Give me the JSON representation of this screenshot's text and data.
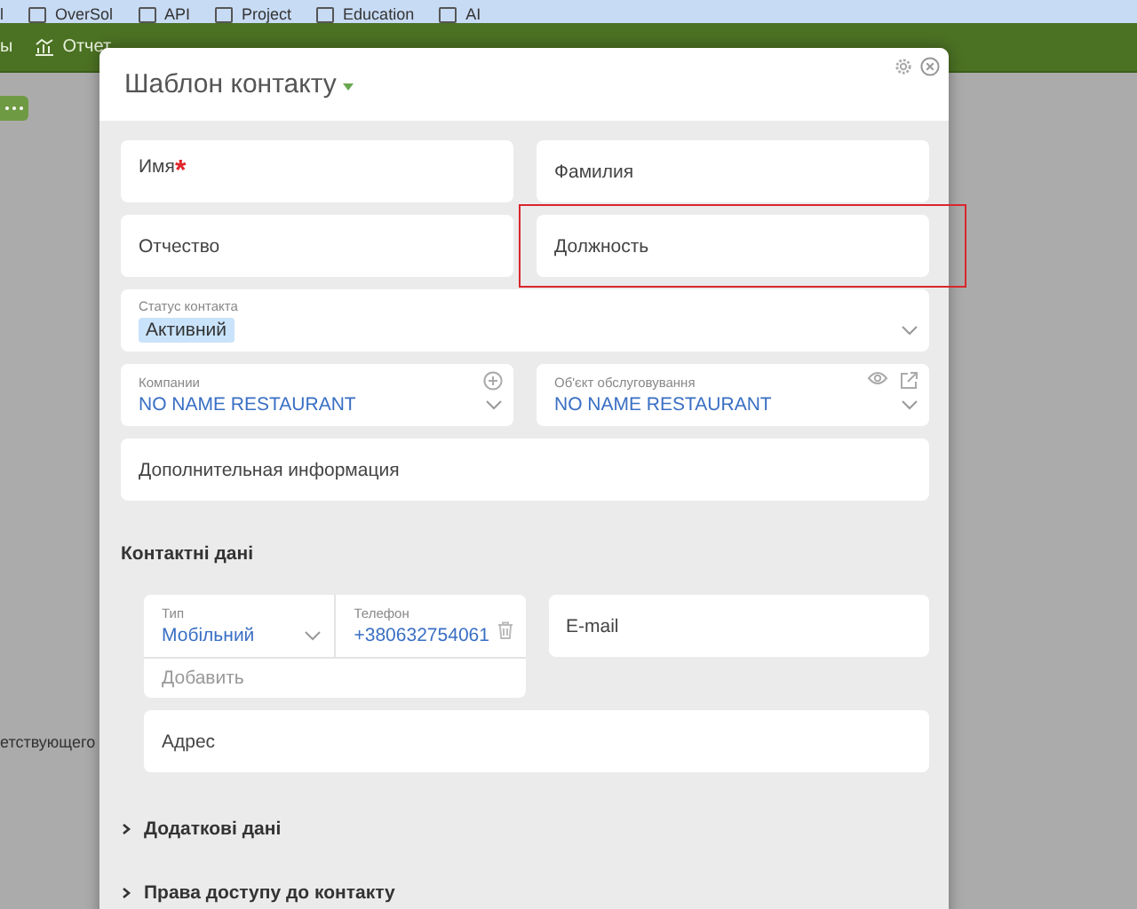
{
  "bookmarks": [
    {
      "label": "l"
    },
    {
      "label": "OverSol"
    },
    {
      "label": "API"
    },
    {
      "label": "Project"
    },
    {
      "label": "Education"
    },
    {
      "label": "AI"
    }
  ],
  "app_bar": {
    "items": [
      {
        "label": "ы",
        "kind": "text"
      },
      {
        "label": "Отчет",
        "kind": "reports"
      }
    ]
  },
  "background_text": "етствующего",
  "dialog": {
    "title": "Шаблон контакту",
    "fields": [
      {
        "kind": "text",
        "label": "Имя",
        "required_mark": "*",
        "highlighted": false
      },
      {
        "kind": "text",
        "label": "Фамилия",
        "highlighted": false
      },
      {
        "kind": "text",
        "label": "Отчество",
        "highlighted": false
      },
      {
        "kind": "text",
        "label": "Должность",
        "highlighted": true
      },
      {
        "kind": "tags",
        "label": "Статус контакта",
        "tags": [
          "Активний"
        ]
      },
      {
        "kind": "lookup",
        "label": "Компании",
        "value": "NO NAME RESTAURANT",
        "add_button": true
      },
      {
        "kind": "lookup",
        "label": "Об'єкт обслуговування",
        "value": "NO NAME RESTAURANT",
        "view_button": true,
        "open_button": true
      },
      {
        "kind": "memo",
        "label": "Дополнительная информация"
      }
    ],
    "contacts": {
      "title": "Контактні дані",
      "phone": {
        "type_label": "Тип",
        "type": "Мобільний",
        "number_label": "Телефон",
        "number": "+380632754061",
        "add": "Добавить"
      },
      "email": {
        "label": "E-mail"
      },
      "address": {
        "label": "Адрес"
      }
    },
    "sections": [
      {
        "title": "Додаткові дані",
        "expanded": false
      },
      {
        "title": "Права доступу до контакту",
        "expanded": false
      }
    ]
  }
}
